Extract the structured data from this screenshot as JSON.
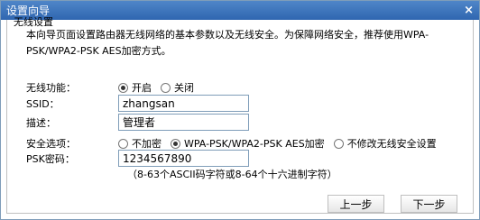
{
  "window": {
    "title": "设置向导",
    "close_glyph": "×"
  },
  "section_title": "无线设置",
  "description": "本向导页面设置路由器无线网络的基本参数以及无线安全。为保障网络安全，推荐使用WPA-PSK/WPA2-PSK AES加密方式。",
  "wireless_function": {
    "label": "无线功能：",
    "options": [
      "开启",
      "关闭"
    ],
    "selected": "开启"
  },
  "ssid": {
    "label": "SSID：",
    "value": "zhangsan"
  },
  "description_field": {
    "label": "描述：",
    "value": "管理者"
  },
  "security": {
    "label": "安全选项：",
    "options": [
      "不加密",
      "WPA-PSK/WPA2-PSK AES加密",
      "不修改无线安全设置"
    ],
    "selected": "WPA-PSK/WPA2-PSK AES加密"
  },
  "psk": {
    "label": "PSK密码：",
    "value": "1234567890",
    "hint": "（8-63个ASCII码字符或8-64个十六进制字符）"
  },
  "buttons": {
    "prev": "上一步",
    "next": "下一步"
  }
}
